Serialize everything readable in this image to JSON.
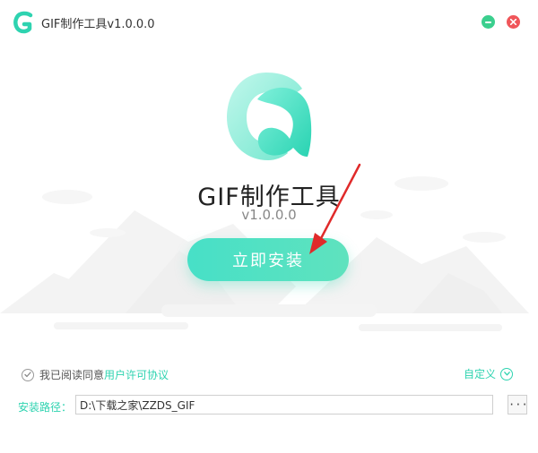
{
  "window": {
    "title": "GIF制作工具v1.0.0.0",
    "accent_color": "#2ed3b0",
    "minimize_color": "#3bcf8e",
    "close_color": "#f0565a"
  },
  "hero": {
    "product_name": "GIF制作工具",
    "version": "v1.0.0.0",
    "install_button_label": "立即安装",
    "logo_icon": "gif-tool-logo-icon"
  },
  "footer": {
    "agree_text": "我已阅读同意",
    "agree_link": "用户许可协议",
    "custom_label": "自定义",
    "path_label": "安装路径：",
    "path_value": "D:\\下载之家\\ZZDS_GIF",
    "browse_label": "···"
  }
}
